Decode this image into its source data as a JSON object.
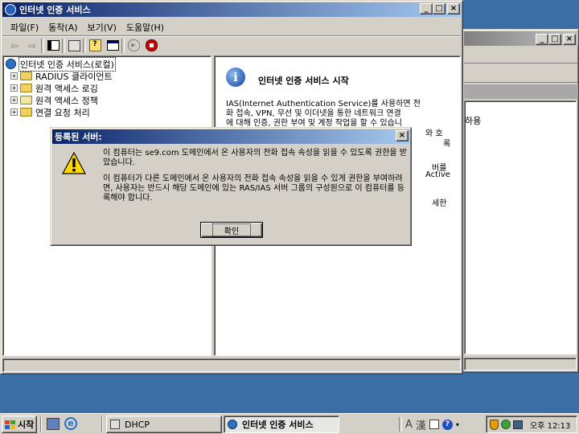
{
  "main_window": {
    "title": "인터넷 인증 서비스",
    "menu": [
      "파일(F)",
      "동작(A)",
      "보기(V)",
      "도움말(H)"
    ],
    "tree": {
      "root": "인터넷 인증 서비스(로컬)",
      "items": [
        "RADIUS 클라이언트",
        "원격 액세스 로깅",
        "원격 액세스 정책",
        "연결 요청 처리"
      ]
    },
    "right_pane": {
      "heading": "인터넷 인증 서비스 시작",
      "paragraph_lines": [
        "IAS(Internet Authentication Service)를 사용하면 전",
        "화 접속, VPN, 무선 및 이더넷을 통한 네트워크 연결",
        "에 대해 인증, 권한 부여 및 계정 작업을 할 수 있습니"
      ],
      "clip_lines": [
        "와 호",
        "록",
        "버를",
        "Active",
        "세한"
      ]
    }
  },
  "background_window": {
    "title": "",
    "clip_text": "하용"
  },
  "dialog": {
    "title": "등록된 서버:",
    "message1": "이 컴퓨터는 se9.com 도메인에서 온 사용자의 전화 접속 속성을 읽을 수 있도록 권한을 받았습니다.",
    "message2": "이 컴퓨터가 다른 도메인에서 온 사용자의 전화 접속 속성을 읽을 수 있게 권한을 부여하려면, 사용자는 반드시 해당 도메인에 있는 RAS/IAS 서버 그룹의 구성원으로 이 컴퓨터를 등록해야 합니다.",
    "ok_label": "확인"
  },
  "taskbar": {
    "start_label": "시작",
    "tasks": [
      {
        "label": "DHCP",
        "active": false
      },
      {
        "label": "인터넷 인증 서비스",
        "active": true
      }
    ],
    "ime_a": "A",
    "ime_han": "漢",
    "clock": "오후 12:13"
  },
  "colors": {
    "desktop": "#3a6ea5",
    "title_active": "#0a246a",
    "title_inactive": "#808080",
    "face": "#d4d0c8"
  }
}
